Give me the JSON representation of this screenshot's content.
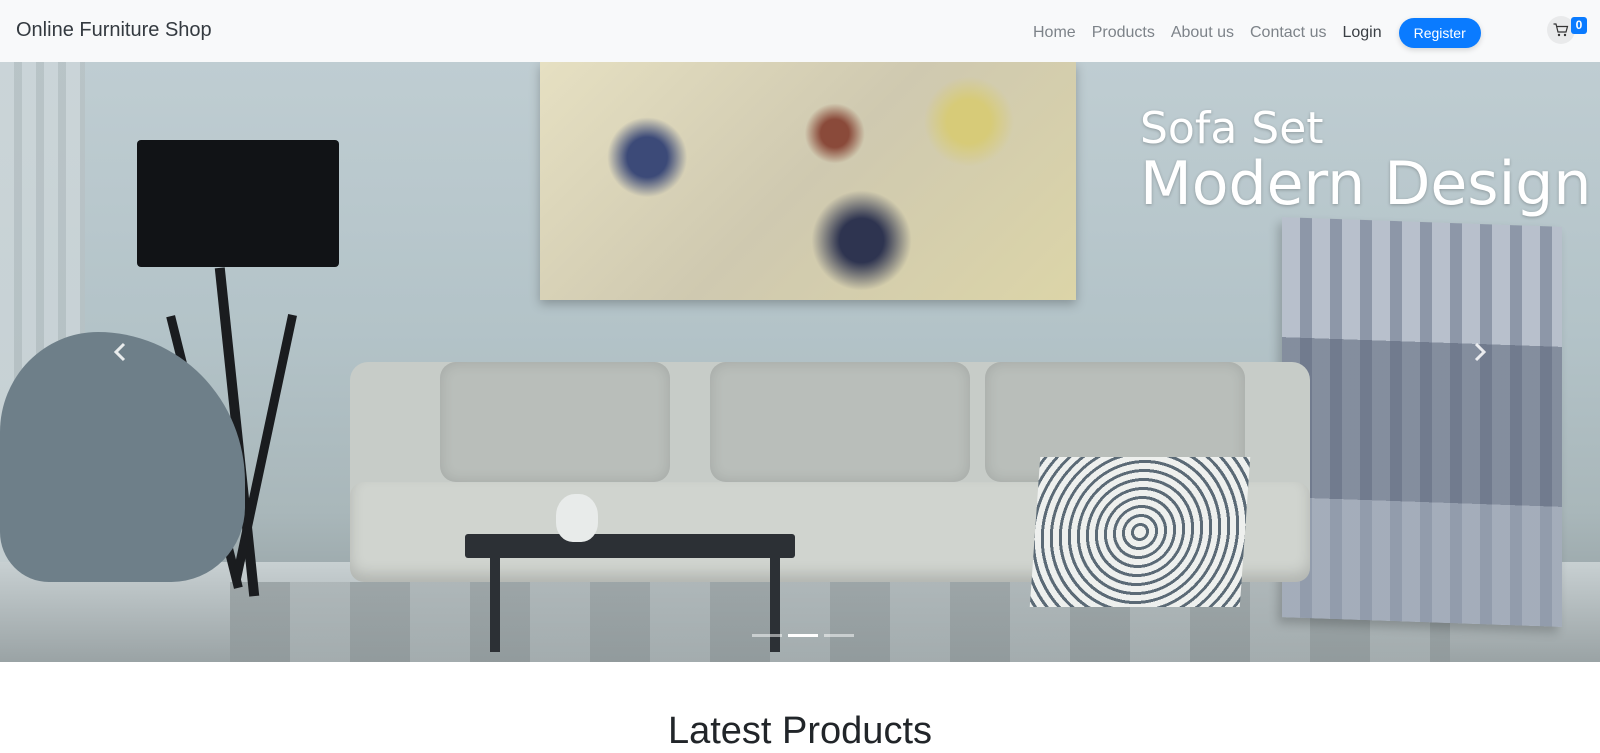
{
  "navbar": {
    "brand": "Online Furniture Shop",
    "links": [
      "Home",
      "Products",
      "About us",
      "Contact us"
    ],
    "login": "Login",
    "register": "Register",
    "cart_count": "0",
    "cart_icon": "shopping-cart-icon"
  },
  "hero": {
    "title_line1": "Sofa Set",
    "title_line2": "Modern Design",
    "prev_icon": "chevron-left-icon",
    "next_icon": "chevron-right-icon",
    "slides": 3,
    "active_slide": 2
  },
  "main": {
    "section_title": "Latest Products"
  },
  "colors": {
    "accent": "#0a7bff",
    "navbar_bg": "#f8f9fa"
  }
}
